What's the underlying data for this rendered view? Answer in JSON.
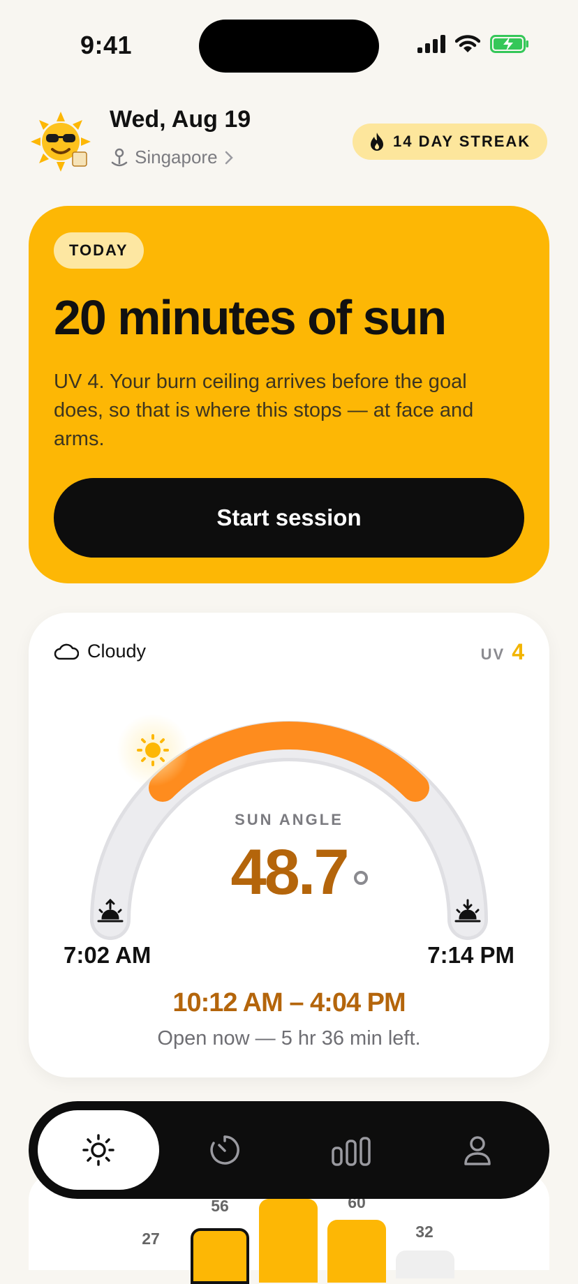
{
  "status": {
    "time": "9:41"
  },
  "header": {
    "date": "Wed, Aug 19",
    "location": "Singapore",
    "streak": "14 DAY STREAK"
  },
  "today": {
    "pill": "TODAY",
    "title": "20 minutes of sun",
    "description": "UV 4. Your burn ceiling arrives before the goal does, so that is where this stops — at face and arms.",
    "button": "Start session"
  },
  "sun": {
    "weather": "Cloudy",
    "uv_label": "UV",
    "uv_value": "4",
    "angle_label": "SUN ANGLE",
    "angle_value": "48.7",
    "sunrise": "7:02 AM",
    "sunset": "7:14 PM",
    "window": "10:12 AM – 4:04 PM",
    "window_sub": "Open now — 5 hr 36 min left."
  },
  "tabs": [
    {
      "icon": "sun-icon",
      "active": true
    },
    {
      "icon": "timer-icon",
      "active": false
    },
    {
      "icon": "stats-icon",
      "active": false
    },
    {
      "icon": "profile-icon",
      "active": false
    }
  ],
  "peek_chart": {
    "values": [
      "27",
      "56",
      "",
      "60",
      "32"
    ]
  },
  "colors": {
    "accent": "#fdb705",
    "arc": "#fe8c1e",
    "angle_text": "#b4650b",
    "background": "#f8f6f1"
  }
}
